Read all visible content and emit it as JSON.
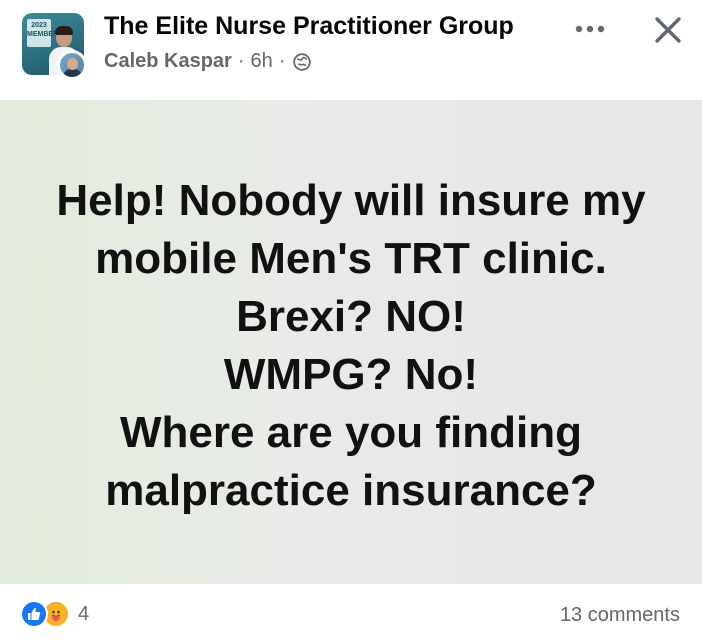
{
  "header": {
    "group_name": "The Elite Nurse Practitioner Group",
    "author": "Caleb Kaspar",
    "time": "6h",
    "separator": "·",
    "audience_icon": "globe-icon",
    "avatar_badge": "2023 MEMBER"
  },
  "post": {
    "lines": [
      "Help! Nobody will insure my",
      "mobile Men's TRT clinic.",
      "Brexi? NO!",
      "WMPG? No!",
      "Where are you finding",
      "malpractice insurance?"
    ],
    "background_left": "#e3ecdd",
    "background_right": "#e6e7e6"
  },
  "footer": {
    "reaction_icons": [
      "like-icon",
      "care-icon"
    ],
    "reaction_count": "4",
    "comments": "13 comments"
  },
  "colors": {
    "primary_text": "#050505",
    "secondary_text": "#65676b",
    "like_blue": "#1877f2",
    "care_yellow": "#f7b125"
  }
}
